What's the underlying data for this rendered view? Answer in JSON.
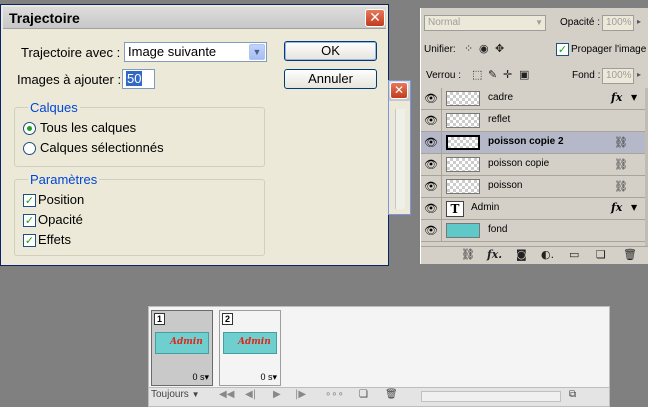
{
  "dialog": {
    "title": "Trajectoire",
    "trajectory_label": "Trajectoire avec :",
    "trajectory_value": "Image suivante",
    "frames_label": "Images à ajouter :",
    "frames_value": "50",
    "ok_label": "OK",
    "cancel_label": "Annuler",
    "layers_group": {
      "legend": "Calques",
      "options": [
        {
          "label": "Tous les calques",
          "selected": true
        },
        {
          "label": "Calques sélectionnés",
          "selected": false
        }
      ]
    },
    "params_group": {
      "legend": "Paramètres",
      "options": [
        {
          "label": "Position",
          "checked": true
        },
        {
          "label": "Opacité",
          "checked": true
        },
        {
          "label": "Effets",
          "checked": true
        }
      ]
    }
  },
  "layers_panel": {
    "blend_mode": "Normal",
    "opacity_label": "Opacité :",
    "opacity_value": "100%",
    "unify_label": "Unifier:",
    "propagate_label": "Propager l'image",
    "lock_label": "Verrou :",
    "fill_label": "Fond :",
    "fill_value": "100%",
    "layers": [
      {
        "name": "cadre",
        "fx": true,
        "linked": false,
        "selected": false,
        "thumb": "transparent"
      },
      {
        "name": "reflet",
        "fx": false,
        "linked": false,
        "selected": false,
        "thumb": "transparent"
      },
      {
        "name": "poisson copie 2",
        "fx": false,
        "linked": true,
        "selected": true,
        "thumb": "transparent"
      },
      {
        "name": "poisson copie",
        "fx": false,
        "linked": true,
        "selected": false,
        "thumb": "transparent"
      },
      {
        "name": "poisson",
        "fx": false,
        "linked": true,
        "selected": false,
        "thumb": "transparent"
      },
      {
        "name": "Admin",
        "fx": true,
        "linked": false,
        "selected": false,
        "thumb": "text"
      },
      {
        "name": "fond",
        "fx": false,
        "linked": false,
        "selected": false,
        "thumb": "teal"
      }
    ]
  },
  "animation_panel": {
    "frames": [
      {
        "number": "1",
        "delay": "0 s",
        "thumb_text": "Admin",
        "selected": true
      },
      {
        "number": "2",
        "delay": "0 s",
        "thumb_text": "Admin",
        "selected": false
      }
    ],
    "loop_value": "Toujours"
  },
  "colors": {
    "dialog_bg": "#ece9d8",
    "legend_blue": "#0046d5",
    "selected_layer": "#b5b8c8",
    "teal_thumb": "#5fc8c8",
    "admin_red": "#e0261b"
  }
}
